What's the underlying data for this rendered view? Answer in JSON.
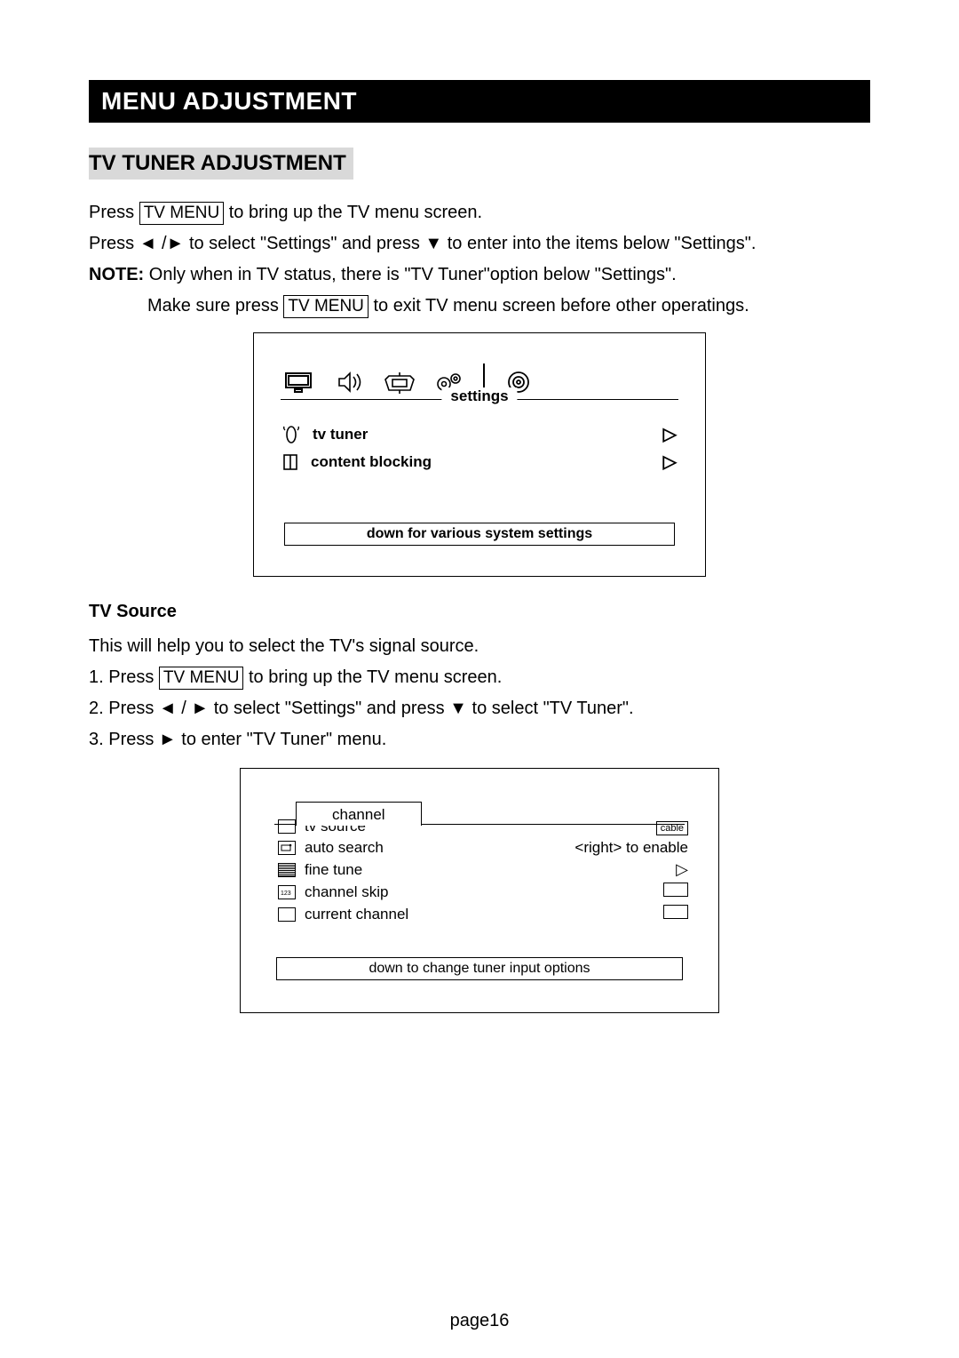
{
  "title": "MENU ADJUSTMENT",
  "section_heading": "TV TUNER ADJUSTMENT",
  "intro": {
    "line1_a": "Press ",
    "key1": "TV MENU",
    "line1_b": " to bring up the TV menu screen.",
    "line2": "Press ◄ /► to select \"Settings\" and press ▼ to enter into the items below \"Settings\".",
    "note_label": "NOTE:",
    "note_text": " Only when in TV status, there is \"TV Tuner\"option below \"Settings\".",
    "line3_a": "Make sure press ",
    "key2": "TV MENU",
    "line3_b": " to exit TV menu screen before other operatings."
  },
  "menu1": {
    "tab_label": "settings",
    "items": [
      {
        "label": "tv tuner"
      },
      {
        "label": "content  blocking"
      }
    ],
    "hint": "down for various system settings"
  },
  "tv_source": {
    "heading": "TV Source",
    "lead": "This will help you to select the TV's signal source.",
    "step1_a": "1. Press ",
    "step1_key": "TV MENU",
    "step1_b": " to bring up the TV menu screen.",
    "step2": "2. Press  ◄ /  ► to select  \"Settings\" and press  ▼ to select \"TV Tuner\".",
    "step3": "3. Press ► to enter \"TV Tuner\" menu."
  },
  "menu2": {
    "tab_label": "channel",
    "rows": {
      "tv_source": {
        "label": "tv source",
        "value": "cable"
      },
      "auto_search": {
        "label": "auto search",
        "value": "<right> to enable"
      },
      "fine_tune": {
        "label": "fine tune"
      },
      "channel_skip": {
        "label": "channel skip"
      },
      "current_channel": {
        "label": "current channel"
      }
    },
    "hint": "down to change tuner  input options"
  },
  "footer": "page16"
}
